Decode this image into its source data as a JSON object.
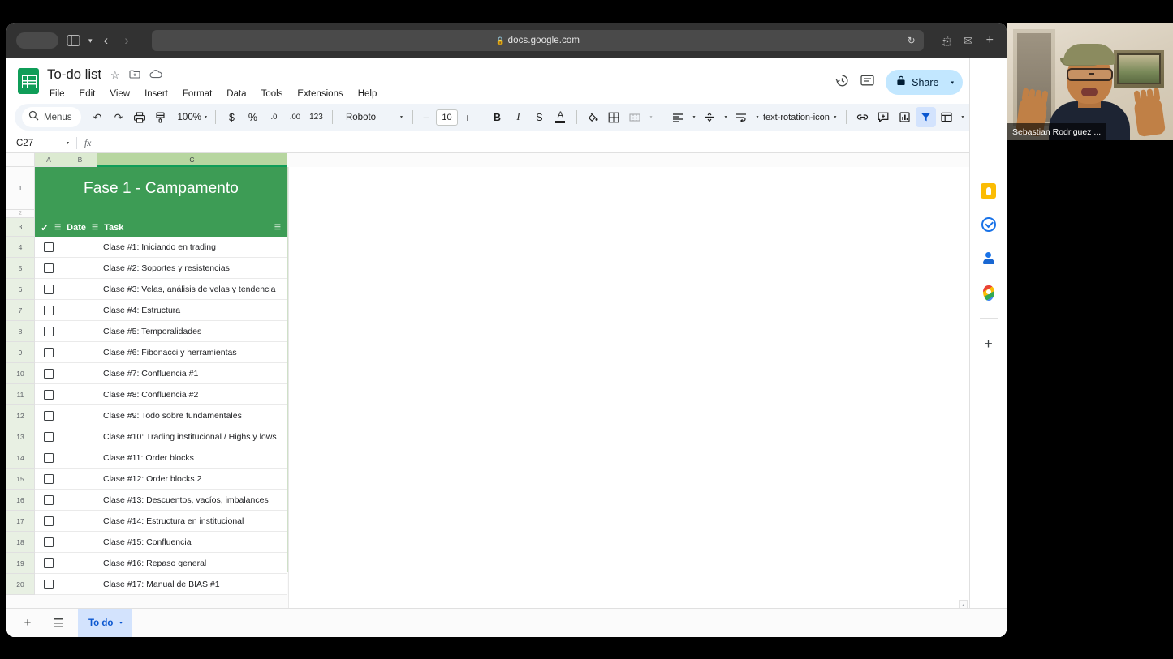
{
  "browser": {
    "url": "docs.google.com",
    "lock_icon": "lock-icon",
    "reload_icon": "reload-icon",
    "tab_overview_icon": "tab-overview-icon",
    "sidebar_icon": "sidebar-toggle-icon",
    "sidebar_caret": "chevron-down-icon",
    "back_arrow": "‹",
    "forward_arrow": "›",
    "download_icon": "download-icon",
    "share_icon": "share-icon",
    "new_tab_icon": "+"
  },
  "app": {
    "doc_title": "To-do list",
    "logo": "google-sheets-logo",
    "title_icons": [
      "star-icon",
      "move-to-folder-icon",
      "cloud-saved-icon"
    ],
    "menus": [
      "File",
      "Edit",
      "View",
      "Insert",
      "Format",
      "Data",
      "Tools",
      "Extensions",
      "Help"
    ],
    "history_icon": "version-history-icon",
    "comment_icon": "comment-icon",
    "share_label": "Share",
    "share_lock_icon": "lock-icon",
    "share_caret": "▾",
    "avatar": "user-avatar"
  },
  "toolbar": {
    "search_label": "Menus",
    "search_icon": "search-icon",
    "undo_icon": "↶",
    "redo_icon": "↷",
    "print_icon": "print-icon",
    "paint_icon": "paint-format-icon",
    "zoom_value": "100%",
    "currency_icon": "$",
    "percent_icon": "%",
    "decrease_decimal_icon": ".0",
    "increase_decimal_icon": ".00",
    "more_formats_icon": "123",
    "font_name": "Roboto",
    "font_size": "10",
    "font_minus": "−",
    "font_plus": "+",
    "bold_icon": "B",
    "italic_icon": "I",
    "strikethrough_icon": "S",
    "text_color_icon": "A",
    "fill_color_icon": "fill-color-icon",
    "borders_icon": "borders-icon",
    "merge_icon": "merge-cells-icon",
    "halign_icon": "horizontal-align-icon",
    "valign_icon": "vertical-align-icon",
    "wrap_icon": "text-wrap-icon",
    "rotate_icon": "text-rotation-icon",
    "link_icon": "insert-link-icon",
    "comment_add_icon": "insert-comment-icon",
    "chart_icon": "insert-chart-icon",
    "filter_icon": "filter-icon",
    "functions_icon": "Σ",
    "pivot_icon": "pivot-table-icon",
    "collapse_icon": "chevron-up-icon"
  },
  "formula_bar": {
    "name_box": "C27",
    "name_caret": "▾",
    "fx_label": "fx",
    "formula_value": ""
  },
  "grid": {
    "columns": [
      "A",
      "B",
      "C"
    ],
    "selected_column": "C",
    "banner_title": "Fase 1 - Campamento",
    "banner_row_number": "1",
    "hidden_row_number": "2",
    "header_row_number": "3",
    "header": {
      "check_icon": "✓",
      "date_label": "Date",
      "task_label": "Task",
      "filter_icon": "filter-dropdown-icon"
    },
    "rows": [
      {
        "num": "4",
        "task": "Clase #1: Iniciando en trading"
      },
      {
        "num": "5",
        "task": "Clase #2: Soportes y resistencias"
      },
      {
        "num": "6",
        "task": "Clase #3: Velas, análisis de velas y tendencia"
      },
      {
        "num": "7",
        "task": "Clase #4: Estructura"
      },
      {
        "num": "8",
        "task": "Clase #5: Temporalidades"
      },
      {
        "num": "9",
        "task": "Clase #6: Fibonacci y herramientas"
      },
      {
        "num": "10",
        "task": "Clase #7: Confluencia #1"
      },
      {
        "num": "11",
        "task": "Clase #8: Confluencia #2"
      },
      {
        "num": "12",
        "task": "Clase #9: Todo sobre fundamentales"
      },
      {
        "num": "13",
        "task": "Clase #10: Trading institucional / Highs y lows"
      },
      {
        "num": "14",
        "task": "Clase #11: Order blocks"
      },
      {
        "num": "15",
        "task": "Clase #12: Order blocks 2"
      },
      {
        "num": "16",
        "task": "Clase #13: Descuentos, vacíos, imbalances"
      },
      {
        "num": "17",
        "task": "Clase #14: Estructura en institucional"
      },
      {
        "num": "18",
        "task": "Clase #15: Confluencia"
      },
      {
        "num": "19",
        "task": "Clase #16: Repaso general"
      },
      {
        "num": "20",
        "task": "Clase #17: Manual de BIAS #1"
      }
    ]
  },
  "side_panel": {
    "items": [
      "keep-icon",
      "tasks-icon",
      "contacts-icon",
      "maps-icon"
    ],
    "add_label": "+",
    "expand_icon": "›"
  },
  "sheet_bar": {
    "add_sheet_icon": "+",
    "all_sheets_icon": "☰",
    "active_tab": "To do",
    "tab_caret": "▾"
  },
  "video": {
    "participant_name": "Sebastian Rodriguez ..."
  },
  "colors": {
    "sheets_green": "#0f9d58",
    "banner_green": "#3d9c55",
    "share_blue": "#c2e7ff",
    "tab_blue": "#d3e3fd",
    "tab_text_blue": "#0b57d0",
    "chrome_dark": "#323232"
  }
}
